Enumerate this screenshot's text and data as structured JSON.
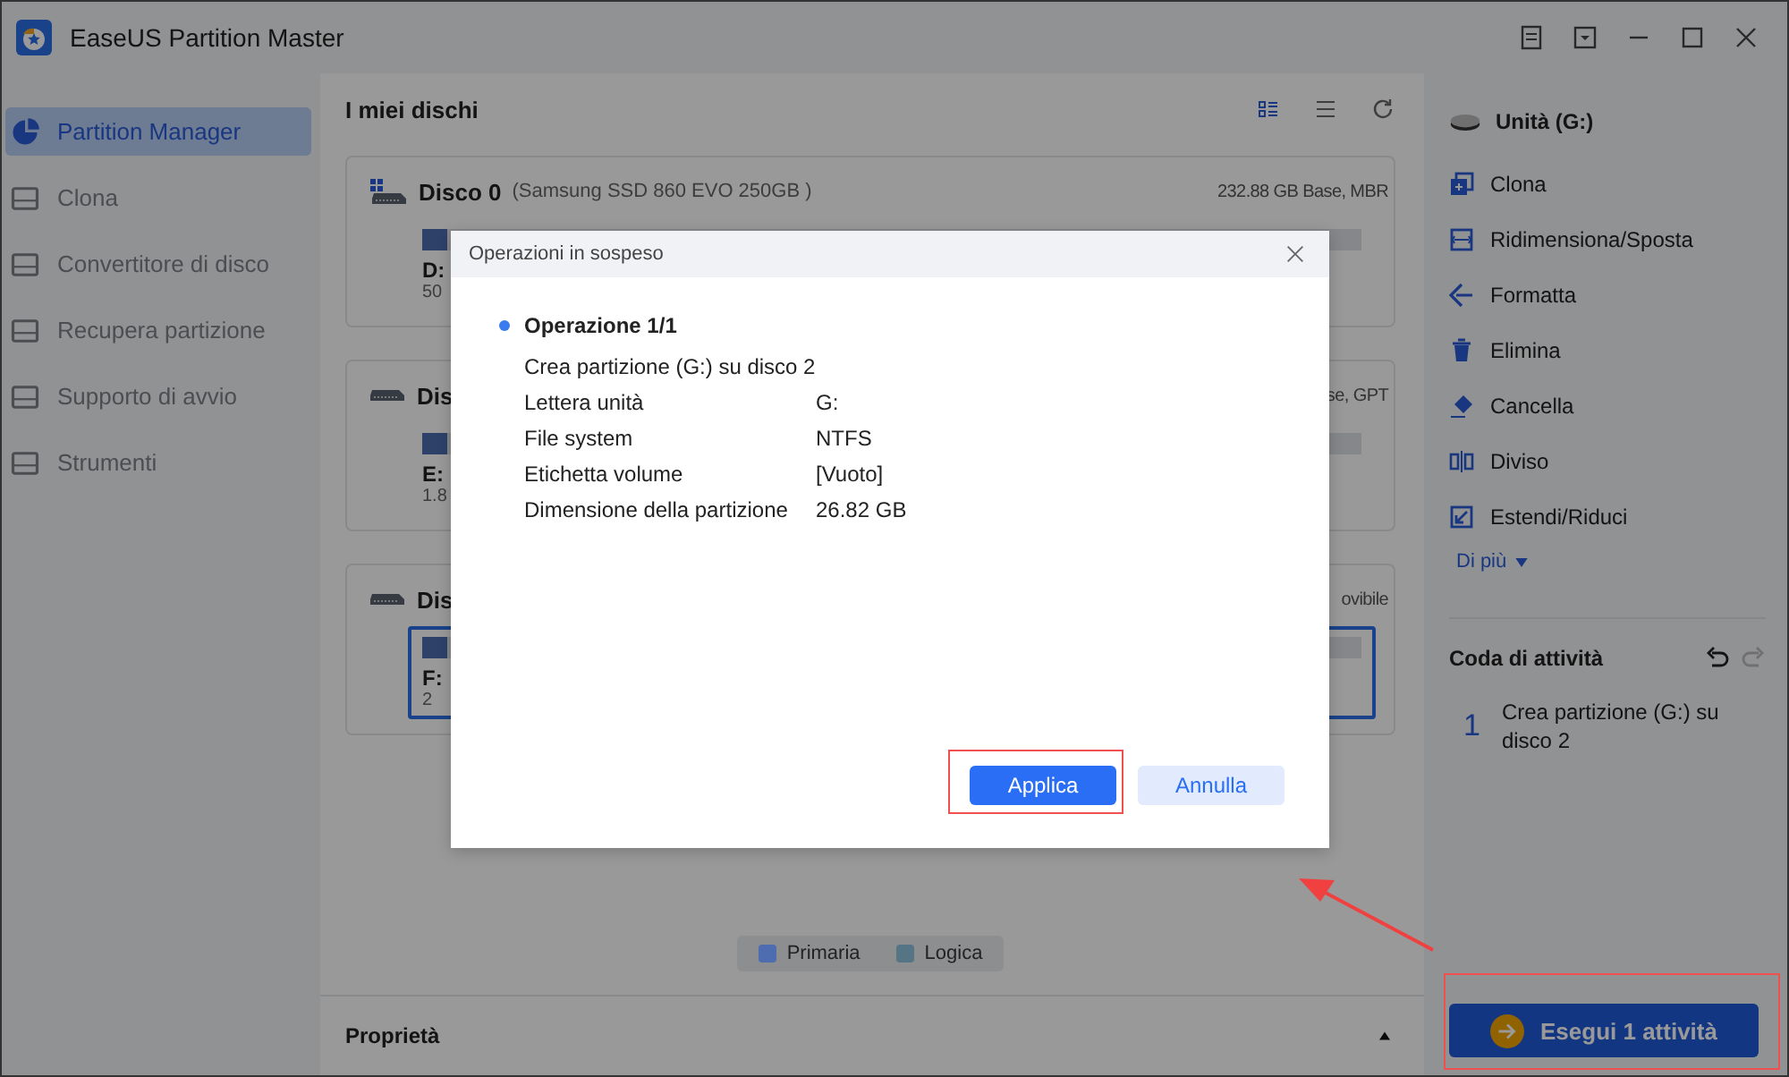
{
  "window": {
    "title": "EaseUS Partition Master"
  },
  "sidebar": {
    "items": [
      {
        "label": "Partition Manager",
        "selected": true,
        "disabled": false
      },
      {
        "label": "Clona",
        "selected": false,
        "disabled": true
      },
      {
        "label": "Convertitore di disco",
        "selected": false,
        "disabled": true
      },
      {
        "label": "Recupera partizione",
        "selected": false,
        "disabled": true
      },
      {
        "label": "Supporto di avvio",
        "selected": false,
        "disabled": true
      },
      {
        "label": "Strumenti",
        "selected": false,
        "disabled": true
      }
    ]
  },
  "main": {
    "title": "I miei dischi",
    "disks": [
      {
        "kind": "system",
        "name": "Disco 0",
        "model": "(Samsung SSD 860 EVO 250GB )",
        "info": "232.88 GB Base, MBR",
        "letter": "D:",
        "size": "50",
        "selected": false
      },
      {
        "kind": "basic",
        "name": "Dis",
        "info": "se, GPT",
        "letter": "E:",
        "size": "1.8",
        "selected": false
      },
      {
        "kind": "basic",
        "name": "Dis",
        "info": "ovibile",
        "letter": "F:",
        "size": "2",
        "selected": true
      }
    ],
    "legend": [
      {
        "label": "Primaria",
        "color": "#4d6db0"
      },
      {
        "label": "Logica",
        "color": "#567584"
      }
    ],
    "properties": {
      "title": "Proprietà"
    }
  },
  "right_panel": {
    "drive": "Unità (G:)",
    "actions": [
      {
        "kind": "clone",
        "label": "Clona"
      },
      {
        "kind": "resize",
        "label": "Ridimensiona/Sposta"
      },
      {
        "kind": "format",
        "label": "Formatta"
      },
      {
        "kind": "delete",
        "label": "Elimina"
      },
      {
        "kind": "wipe",
        "label": "Cancella"
      },
      {
        "kind": "split",
        "label": "Diviso"
      },
      {
        "kind": "extend",
        "label": "Estendi/Riduci"
      }
    ],
    "more": "Di più",
    "queue": {
      "title": "Coda di attività",
      "items": [
        {
          "number": "1",
          "text": "Crea partizione (G:) su disco 2"
        }
      ]
    },
    "execute": "Esegui 1 attività"
  },
  "dialog": {
    "title": "Operazioni in sospeso",
    "operation": "Operazione 1/1",
    "description": "Crea partizione (G:) su disco 2",
    "rows": [
      {
        "label": "Lettera unità",
        "value": "G:"
      },
      {
        "label": "File system",
        "value": "NTFS"
      },
      {
        "label": "Etichetta volume",
        "value": "[Vuoto]"
      },
      {
        "label": "Dimensione della partizione",
        "value": "26.82 GB"
      }
    ],
    "apply": "Applica",
    "cancel": "Annulla"
  }
}
